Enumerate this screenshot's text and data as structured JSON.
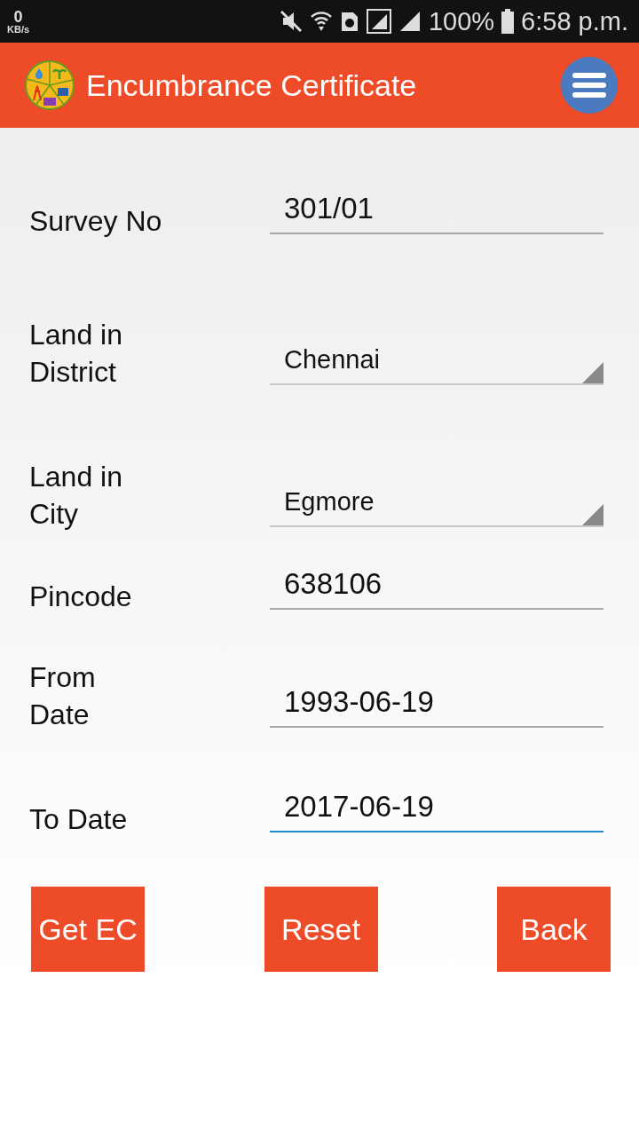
{
  "status_bar": {
    "speed": "0",
    "speed_unit": "KB/s",
    "battery": "100%",
    "time": "6:58 p.m."
  },
  "app_bar": {
    "title": "Encumbrance Certificate"
  },
  "fields": [
    {
      "kind": "text",
      "label": "Survey No",
      "value": "301/01",
      "focused": false
    },
    {
      "kind": "dropdown",
      "label": "Land in District",
      "value": "Chennai"
    },
    {
      "kind": "dropdown",
      "label": "Land in City",
      "value": "Egmore"
    },
    {
      "kind": "text",
      "label": "Pincode",
      "value": "638106",
      "focused": false
    },
    {
      "kind": "text",
      "label": "From Date",
      "value": "1993-06-19",
      "focused": false
    },
    {
      "kind": "text",
      "label": "To Date",
      "value": "2017-06-19",
      "focused": true
    }
  ],
  "buttons": [
    "Get EC",
    "Reset",
    "Back"
  ]
}
